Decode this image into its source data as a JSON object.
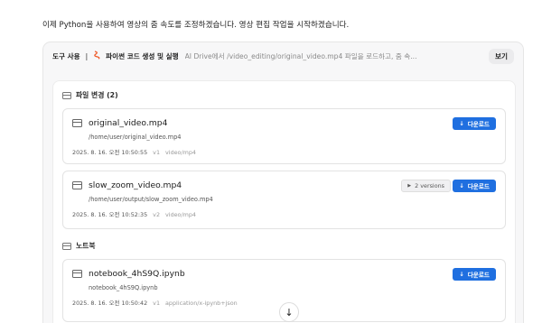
{
  "intro_text": "이제 Python을 사용하여 영상의 줌 속도를 조정하겠습니다. 영상 편집 작업을 시작하겠습니다.",
  "toolbar": {
    "label": "도구 사용",
    "separator": "|",
    "tool_icon": "code-tool-icon",
    "tool_name": "파이썬 코드 생성 및 실행",
    "description": "AI Drive에서 /video_editing/original_video.mp4 파일을 로드하고, 줌 속...",
    "view_label": "보기"
  },
  "file_changes": {
    "title": "파일 변경 (2)",
    "files": [
      {
        "name": "original_video.mp4",
        "path": "/home/user/original_video.mp4",
        "date": "2025. 8. 16. 오전 10:50:55",
        "version": "v1",
        "mime": "video/mp4",
        "download_label": "다운로드"
      },
      {
        "name": "slow_zoom_video.mp4",
        "path": "/home/user/output/slow_zoom_video.mp4",
        "date": "2025. 8. 16. 오전 10:52:35",
        "version": "v2",
        "mime": "video/mp4",
        "versions_label": "2 versions",
        "download_label": "다운로드"
      }
    ]
  },
  "notebook": {
    "title": "노트북",
    "files": [
      {
        "name": "notebook_4hS9Q.ipynb",
        "path": "notebook_4hS9Q.ipynb",
        "date": "2025. 8. 16. 오전 10:50:42",
        "version": "v1",
        "mime": "application/x-ipynb+json",
        "download_label": "다운로드"
      }
    ]
  },
  "scroll_down_icon": "arrow-down-icon",
  "colors": {
    "accent": "#1f6fe0",
    "tool_icon": "#ef5a28"
  }
}
